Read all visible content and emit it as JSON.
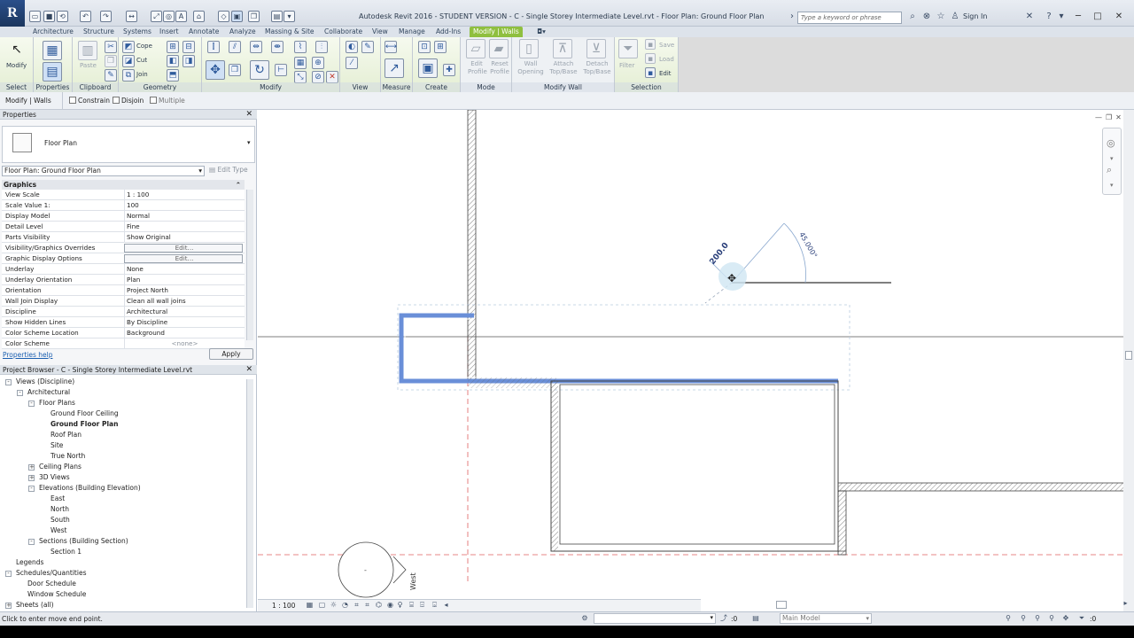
{
  "app": {
    "logo_letter": "R",
    "window_title": "Autodesk Revit 2016 - STUDENT VERSION -   C - Single Storey Intermediate Level.rvt - Floor Plan: Ground Floor Plan",
    "search_placeholder": "Type a keyword or phrase",
    "sign_in": "Sign In"
  },
  "ribbon_tabs": [
    "Architecture",
    "Structure",
    "Systems",
    "Insert",
    "Annotate",
    "Analyze",
    "Massing & Site",
    "Collaborate",
    "View",
    "Manage",
    "Add-Ins",
    "Modify | Walls"
  ],
  "ribbon": {
    "modify_label": "Modify",
    "paste_label": "Paste",
    "cope_label": "Cope",
    "cut_label": "Cut",
    "join_label": "Join",
    "edit_profile": "Edit Profile",
    "reset_profile": "Reset Profile",
    "wall_opening": "Wall Opening",
    "attach_top_base": "Attach Top/Base",
    "detach_top_base": "Detach Top/Base",
    "filter_label": "Filter",
    "save_label": "Save",
    "load_label": "Load",
    "edit_label": "Edit",
    "panels": {
      "select": "Select",
      "properties": "Properties",
      "clipboard": "Clipboard",
      "geometry": "Geometry",
      "modify": "Modify",
      "view": "View",
      "measure": "Measure",
      "create": "Create",
      "mode": "Mode",
      "modify_wall": "Modify Wall",
      "selection": "Selection"
    }
  },
  "options_bar": {
    "context": "Modify | Walls",
    "constrain": "Constrain",
    "disjoin": "Disjoin",
    "multiple": "Multiple"
  },
  "properties": {
    "title": "Properties",
    "type_name": "Floor Plan",
    "instance": "Floor Plan: Ground Floor Plan",
    "edit_type": "Edit Type",
    "group": "Graphics",
    "rows": [
      {
        "name": "View Scale",
        "value": "1 : 100"
      },
      {
        "name": "Scale Value    1:",
        "value": "100"
      },
      {
        "name": "Display Model",
        "value": "Normal"
      },
      {
        "name": "Detail Level",
        "value": "Fine"
      },
      {
        "name": "Parts Visibility",
        "value": "Show Original"
      },
      {
        "name": "Visibility/Graphics Overrides",
        "value": "Edit..."
      },
      {
        "name": "Graphic Display Options",
        "value": "Edit..."
      },
      {
        "name": "Underlay",
        "value": "None"
      },
      {
        "name": "Underlay Orientation",
        "value": "Plan"
      },
      {
        "name": "Orientation",
        "value": "Project North"
      },
      {
        "name": "Wall Join Display",
        "value": "Clean all wall joins"
      },
      {
        "name": "Discipline",
        "value": "Architectural"
      },
      {
        "name": "Show Hidden Lines",
        "value": "By Discipline"
      },
      {
        "name": "Color Scheme Location",
        "value": "Background"
      },
      {
        "name": "Color Scheme",
        "value": "<none>"
      }
    ],
    "help": "Properties help",
    "apply": "Apply"
  },
  "browser": {
    "title": "Project Browser - C - Single Storey Intermediate Level.rvt",
    "nodes": [
      {
        "label": "Views (Discipline)",
        "level": 0,
        "exp": "-"
      },
      {
        "label": "Architectural",
        "level": 1,
        "exp": "-"
      },
      {
        "label": "Floor Plans",
        "level": 2,
        "exp": "-"
      },
      {
        "label": "Ground Floor Ceiling",
        "level": 3,
        "exp": ""
      },
      {
        "label": "Ground Floor Plan",
        "level": 3,
        "exp": "",
        "bold": true
      },
      {
        "label": "Roof Plan",
        "level": 3,
        "exp": ""
      },
      {
        "label": "Site",
        "level": 3,
        "exp": ""
      },
      {
        "label": "True North",
        "level": 3,
        "exp": ""
      },
      {
        "label": "Ceiling Plans",
        "level": 2,
        "exp": "+"
      },
      {
        "label": "3D Views",
        "level": 2,
        "exp": "+"
      },
      {
        "label": "Elevations (Building Elevation)",
        "level": 2,
        "exp": "-"
      },
      {
        "label": "East",
        "level": 3,
        "exp": ""
      },
      {
        "label": "North",
        "level": 3,
        "exp": ""
      },
      {
        "label": "South",
        "level": 3,
        "exp": ""
      },
      {
        "label": "West",
        "level": 3,
        "exp": ""
      },
      {
        "label": "Sections (Building Section)",
        "level": 2,
        "exp": "-"
      },
      {
        "label": "Section 1",
        "level": 3,
        "exp": ""
      },
      {
        "label": "Legends",
        "level": 0,
        "exp": ""
      },
      {
        "label": "Schedules/Quantities",
        "level": 0,
        "exp": "-"
      },
      {
        "label": "Door Schedule",
        "level": 1,
        "exp": ""
      },
      {
        "label": "Window Schedule",
        "level": 1,
        "exp": ""
      },
      {
        "label": "Sheets (all)",
        "level": 0,
        "exp": "+"
      }
    ]
  },
  "canvas": {
    "dim_length": "200.0",
    "dim_angle": "45.000°",
    "elevation_label": "West",
    "elevation_dash": "-"
  },
  "view_bar": {
    "scale": "1 : 100"
  },
  "status": {
    "message": "Click to enter move end point.",
    "workset_count": ":0",
    "design_option": "Main Model",
    "filter_count": ":0"
  },
  "colors": {
    "accent_tab": "#8fbf3f",
    "selection_blue": "#6a8fd8",
    "elevation_line": "#e06060",
    "dimension": "#2a3f7a"
  }
}
